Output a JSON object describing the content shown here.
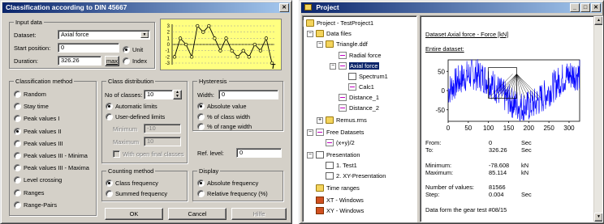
{
  "dialog": {
    "title": "Classification according to DIN 45667",
    "close_glyph": "✕",
    "input": {
      "legend": "Input data",
      "dataset_label": "Dataset:",
      "dataset_value": "Axial force",
      "start_label": "Start position:",
      "start_value": "0",
      "duration_label": "Duration:",
      "duration_value": "326.26",
      "max_label": "max",
      "unit_label": "Unit",
      "index_label": "Index"
    },
    "preview": {
      "y_ticks": [
        "3",
        "2",
        "1",
        "0",
        "-1",
        "-2",
        "-3"
      ],
      "values": [
        -2,
        1,
        0,
        -2,
        3,
        2,
        3,
        1,
        -1,
        1,
        -1,
        -2,
        -1,
        -2,
        0,
        -1,
        1,
        -3
      ],
      "x_marker": "T"
    },
    "method": {
      "legend": "Classification method",
      "options": [
        "Random",
        "Stay time",
        "Peak values I",
        "Peak values II",
        "Peak values III",
        "Peak values III - Minima",
        "Peak values III - Maxima",
        "Level crossing",
        "Ranges",
        "Range-Pairs"
      ],
      "selected": 3
    },
    "distribution": {
      "legend": "Class distribution",
      "classes_label": "No of classes:",
      "classes_value": "10",
      "auto_label": "Automatic limits",
      "user_label": "User-defined limits",
      "min_label": "Minimum",
      "min_value": "-10",
      "max_label": "Maximum",
      "max_value": "10",
      "open_label": "With open final classes"
    },
    "hysteresis": {
      "legend": "Hysteresis",
      "width_label": "Width:",
      "width_value": "0",
      "abs_label": "Absolute value",
      "class_label": "% of class width",
      "range_label": "% of range width"
    },
    "ref_label": "Ref. level:",
    "ref_value": "0",
    "counting": {
      "legend": "Counting method",
      "class_freq": "Class frequency",
      "summed_freq": "Summed frequency"
    },
    "display": {
      "legend": "Display",
      "abs_freq": "Absolute frequency",
      "rel_freq": "Relative frequency (%)"
    },
    "ok": "OK",
    "cancel": "Cancel",
    "help": "Hilfe"
  },
  "project": {
    "title": "Project",
    "tree": {
      "root": "Project - TestProject1",
      "data_files": "Data files",
      "triangle": "Triangle.ddf",
      "radial": "Radial force",
      "axial": "Axial force",
      "spectrum": "Spectrum1",
      "calc": "Calc1",
      "distance1": "Distance_1",
      "distance2": "Distance_2",
      "remus": "Remus.rms",
      "free": "Free Datasets",
      "expr": "(x+y)/2",
      "presentation": "Presentation",
      "test1": "1. Test1",
      "xypres": "2. XY-Presentation",
      "time": "Time ranges",
      "xt": "XT - Windows",
      "xy": "XY - Windows"
    },
    "detail": {
      "header": "Dataset Axial force - Force   [kN]",
      "entire": "Entire dataset:",
      "y_ticks": [
        "50",
        "0",
        "-50"
      ],
      "x_ticks": [
        "0",
        "50",
        "100",
        "150",
        "200",
        "250",
        "300"
      ],
      "from_label": "From:",
      "from_value": "0",
      "from_unit": "Sec",
      "to_label": "To:",
      "to_value": "326.26",
      "to_unit": "Sec",
      "min_label": "Minimum:",
      "min_value": "-78.608",
      "min_unit": "kN",
      "max_label": "Maximum:",
      "max_value": "85.114",
      "max_unit": "kN",
      "count_label": "Number of values:",
      "count_value": "81566",
      "step_label": "Step:",
      "step_value": "0.004",
      "step_unit": "Sec",
      "note": "Data form the gear test #08/15"
    }
  }
}
